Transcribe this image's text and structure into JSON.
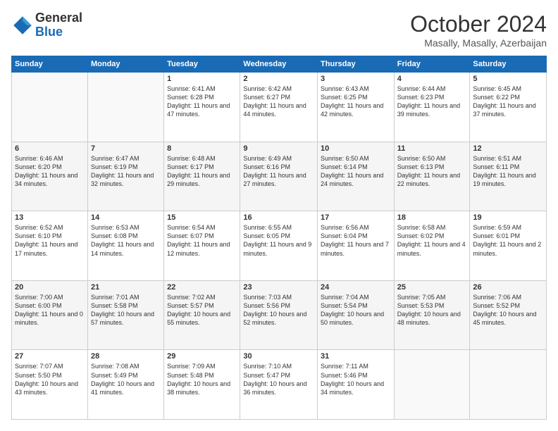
{
  "header": {
    "logo_line1": "General",
    "logo_line2": "Blue",
    "month": "October 2024",
    "location": "Masally, Masally, Azerbaijan"
  },
  "days_of_week": [
    "Sunday",
    "Monday",
    "Tuesday",
    "Wednesday",
    "Thursday",
    "Friday",
    "Saturday"
  ],
  "weeks": [
    [
      {
        "day": "",
        "empty": true
      },
      {
        "day": "",
        "empty": true
      },
      {
        "day": "1",
        "sunrise": "6:41 AM",
        "sunset": "6:28 PM",
        "daylight": "11 hours and 47 minutes."
      },
      {
        "day": "2",
        "sunrise": "6:42 AM",
        "sunset": "6:27 PM",
        "daylight": "11 hours and 44 minutes."
      },
      {
        "day": "3",
        "sunrise": "6:43 AM",
        "sunset": "6:25 PM",
        "daylight": "11 hours and 42 minutes."
      },
      {
        "day": "4",
        "sunrise": "6:44 AM",
        "sunset": "6:23 PM",
        "daylight": "11 hours and 39 minutes."
      },
      {
        "day": "5",
        "sunrise": "6:45 AM",
        "sunset": "6:22 PM",
        "daylight": "11 hours and 37 minutes."
      }
    ],
    [
      {
        "day": "6",
        "sunrise": "6:46 AM",
        "sunset": "6:20 PM",
        "daylight": "11 hours and 34 minutes."
      },
      {
        "day": "7",
        "sunrise": "6:47 AM",
        "sunset": "6:19 PM",
        "daylight": "11 hours and 32 minutes."
      },
      {
        "day": "8",
        "sunrise": "6:48 AM",
        "sunset": "6:17 PM",
        "daylight": "11 hours and 29 minutes."
      },
      {
        "day": "9",
        "sunrise": "6:49 AM",
        "sunset": "6:16 PM",
        "daylight": "11 hours and 27 minutes."
      },
      {
        "day": "10",
        "sunrise": "6:50 AM",
        "sunset": "6:14 PM",
        "daylight": "11 hours and 24 minutes."
      },
      {
        "day": "11",
        "sunrise": "6:50 AM",
        "sunset": "6:13 PM",
        "daylight": "11 hours and 22 minutes."
      },
      {
        "day": "12",
        "sunrise": "6:51 AM",
        "sunset": "6:11 PM",
        "daylight": "11 hours and 19 minutes."
      }
    ],
    [
      {
        "day": "13",
        "sunrise": "6:52 AM",
        "sunset": "6:10 PM",
        "daylight": "11 hours and 17 minutes."
      },
      {
        "day": "14",
        "sunrise": "6:53 AM",
        "sunset": "6:08 PM",
        "daylight": "11 hours and 14 minutes."
      },
      {
        "day": "15",
        "sunrise": "6:54 AM",
        "sunset": "6:07 PM",
        "daylight": "11 hours and 12 minutes."
      },
      {
        "day": "16",
        "sunrise": "6:55 AM",
        "sunset": "6:05 PM",
        "daylight": "11 hours and 9 minutes."
      },
      {
        "day": "17",
        "sunrise": "6:56 AM",
        "sunset": "6:04 PM",
        "daylight": "11 hours and 7 minutes."
      },
      {
        "day": "18",
        "sunrise": "6:58 AM",
        "sunset": "6:02 PM",
        "daylight": "11 hours and 4 minutes."
      },
      {
        "day": "19",
        "sunrise": "6:59 AM",
        "sunset": "6:01 PM",
        "daylight": "11 hours and 2 minutes."
      }
    ],
    [
      {
        "day": "20",
        "sunrise": "7:00 AM",
        "sunset": "6:00 PM",
        "daylight": "11 hours and 0 minutes."
      },
      {
        "day": "21",
        "sunrise": "7:01 AM",
        "sunset": "5:58 PM",
        "daylight": "10 hours and 57 minutes."
      },
      {
        "day": "22",
        "sunrise": "7:02 AM",
        "sunset": "5:57 PM",
        "daylight": "10 hours and 55 minutes."
      },
      {
        "day": "23",
        "sunrise": "7:03 AM",
        "sunset": "5:56 PM",
        "daylight": "10 hours and 52 minutes."
      },
      {
        "day": "24",
        "sunrise": "7:04 AM",
        "sunset": "5:54 PM",
        "daylight": "10 hours and 50 minutes."
      },
      {
        "day": "25",
        "sunrise": "7:05 AM",
        "sunset": "5:53 PM",
        "daylight": "10 hours and 48 minutes."
      },
      {
        "day": "26",
        "sunrise": "7:06 AM",
        "sunset": "5:52 PM",
        "daylight": "10 hours and 45 minutes."
      }
    ],
    [
      {
        "day": "27",
        "sunrise": "7:07 AM",
        "sunset": "5:50 PM",
        "daylight": "10 hours and 43 minutes."
      },
      {
        "day": "28",
        "sunrise": "7:08 AM",
        "sunset": "5:49 PM",
        "daylight": "10 hours and 41 minutes."
      },
      {
        "day": "29",
        "sunrise": "7:09 AM",
        "sunset": "5:48 PM",
        "daylight": "10 hours and 38 minutes."
      },
      {
        "day": "30",
        "sunrise": "7:10 AM",
        "sunset": "5:47 PM",
        "daylight": "10 hours and 36 minutes."
      },
      {
        "day": "31",
        "sunrise": "7:11 AM",
        "sunset": "5:46 PM",
        "daylight": "10 hours and 34 minutes."
      },
      {
        "day": "",
        "empty": true
      },
      {
        "day": "",
        "empty": true
      }
    ]
  ]
}
